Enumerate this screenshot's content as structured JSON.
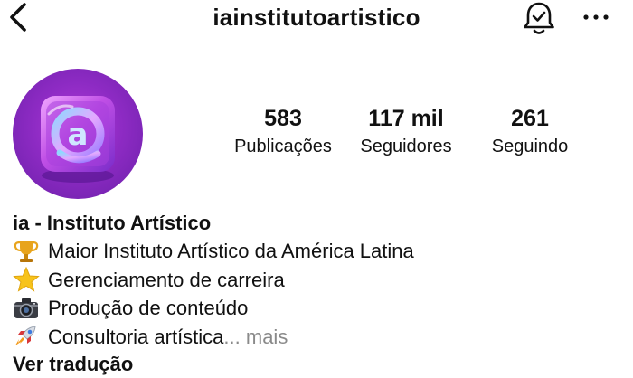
{
  "header": {
    "username": "iainstitutoartistico",
    "icons": [
      "back-chevron-icon",
      "bell-check-icon",
      "more-options-icon"
    ]
  },
  "profile": {
    "avatar_icon": "at-sign-logo-icon",
    "stats": [
      {
        "value": "583",
        "label": "Publicações"
      },
      {
        "value": "117 mil",
        "label": "Seguidores"
      },
      {
        "value": "261",
        "label": "Seguindo"
      }
    ]
  },
  "bio": {
    "name": "ia - Instituto Artístico",
    "lines": [
      {
        "icon": "trophy-icon",
        "text": "Maior Instituto Artístico da América Latina"
      },
      {
        "icon": "star-icon",
        "text": "Gerenciamento de carreira"
      },
      {
        "icon": "camera-icon",
        "text": "Produção de conteúdo"
      },
      {
        "icon": "rocket-icon",
        "text": "Consultoria artística",
        "more_label": "... mais"
      }
    ],
    "translate_label": "Ver tradução"
  },
  "colors": {
    "text": "#111111",
    "muted": "#8a8a8a",
    "avatar_purple": "#8e2bc4"
  }
}
